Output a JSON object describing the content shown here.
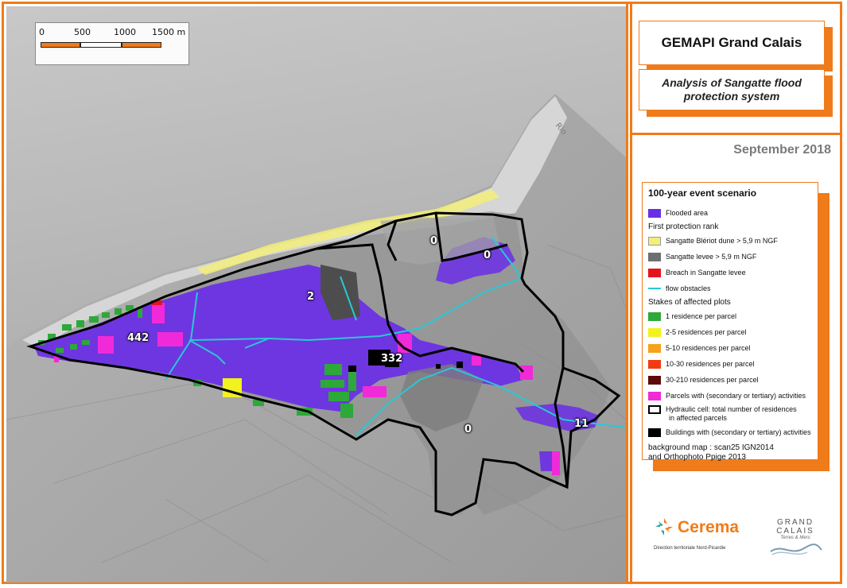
{
  "scale_bar": {
    "labels": [
      "0",
      "500",
      "1000",
      "1500 m"
    ],
    "colors": [
      "#f07b1a",
      "#ffffff",
      "#f07b1a"
    ]
  },
  "map_labels": {
    "cell_west": "442",
    "cell_center": "332",
    "cell_lake": "2",
    "cell_town": "0",
    "cell_small": "0",
    "cell_south": "0",
    "cell_east": "11",
    "coast_text": "Rio"
  },
  "header": {
    "title": "GEMAPI Grand Calais",
    "subtitle": "Analysis of Sangatte flood protection system",
    "date": "September 2018"
  },
  "legend": {
    "title": "100-year event scenario",
    "flooded": {
      "label": "Flooded area",
      "color": "#6a2ee6"
    },
    "first_rank_title": "First protection rank",
    "first_rank": [
      {
        "label": "Sangatte Blériot dune > 5,9 m NGF",
        "color": "#f2ee7a",
        "type": "fill"
      },
      {
        "label": "Sangatte levee > 5,9 m NGF",
        "color": "#6e6e6e",
        "type": "fill"
      },
      {
        "label": "Breach in Sangatte levee",
        "color": "#e5141c",
        "type": "fill"
      },
      {
        "label": "flow obstacles",
        "color": "#29c8d6",
        "type": "line"
      }
    ],
    "stakes_title": "Stakes of affected plots",
    "stakes": [
      {
        "label": "1 residence per parcel",
        "color": "#2ea83a"
      },
      {
        "label": "2-5 residences per parcel",
        "color": "#f2f21e"
      },
      {
        "label": "5-10 residences per parcel",
        "color": "#f7a21b"
      },
      {
        "label": "10-30 residences per parcel",
        "color": "#f23b12"
      },
      {
        "label": "30-210 residences per parcel",
        "color": "#5c0a0a"
      },
      {
        "label": "Parcels with (secondary or tertiary) activities",
        "color": "#f02ad8"
      }
    ],
    "hydraulic_cell": {
      "line1": "Hydraulic cell: total number of residences",
      "line2": "in affected parcels"
    },
    "buildings": {
      "label": "Buildings with (secondary or tertiary) activities",
      "color": "#000000"
    },
    "background": {
      "line1": "background map : scan25 IGN2014",
      "line2": "and Orthophoto Ppige 2013"
    }
  },
  "logos": {
    "cerema_name": "Cerema",
    "cerema_sub": "Direction territoriale Nord-Picardie",
    "gc_line1": "GRAND",
    "gc_line2": "CALAIS",
    "gc_tag": "Terres & Mers"
  },
  "colors": {
    "accent": "#f07b1a",
    "flood": "#6a2ee6",
    "activity": "#f02ad8",
    "obstacle": "#29c8d6"
  }
}
